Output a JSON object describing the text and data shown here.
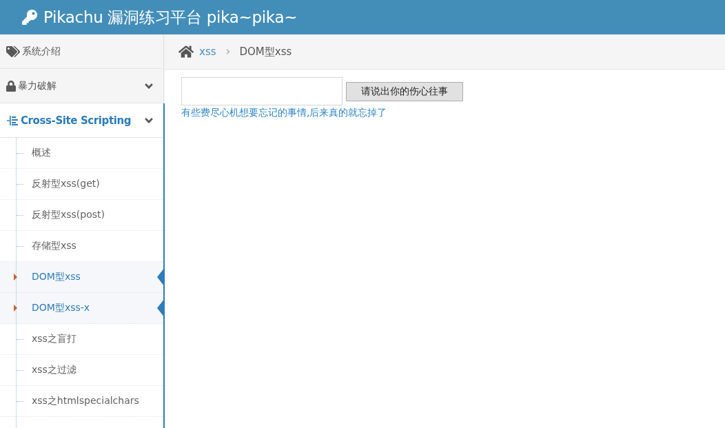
{
  "header": {
    "title": "Pikachu 漏洞练习平台 pika~pika~"
  },
  "sidebar": {
    "items": [
      {
        "label": "系统介绍",
        "kind": "link"
      },
      {
        "label": "暴力破解",
        "kind": "menu",
        "expanded": false
      },
      {
        "label": "Cross-Site Scripting",
        "kind": "menu",
        "expanded": true,
        "children": [
          {
            "label": "概述",
            "selected": false
          },
          {
            "label": "反射型xss(get)",
            "selected": false
          },
          {
            "label": "反射型xss(post)",
            "selected": false
          },
          {
            "label": "存储型xss",
            "selected": false
          },
          {
            "label": "DOM型xss",
            "selected": true
          },
          {
            "label": "DOM型xss-x",
            "selected": true
          },
          {
            "label": "xss之盲打",
            "selected": false
          },
          {
            "label": "xss之过滤",
            "selected": false
          },
          {
            "label": "xss之htmlspecialchars",
            "selected": false
          }
        ]
      }
    ]
  },
  "breadcrumb": [
    {
      "label": "xss",
      "kind": "link"
    },
    {
      "label": "DOM型xss",
      "kind": "current"
    }
  ],
  "form": {
    "button": "请说出你的伤心往事",
    "link": "有些费尽心机想要忘记的事情,后来真的就忘掉了"
  }
}
